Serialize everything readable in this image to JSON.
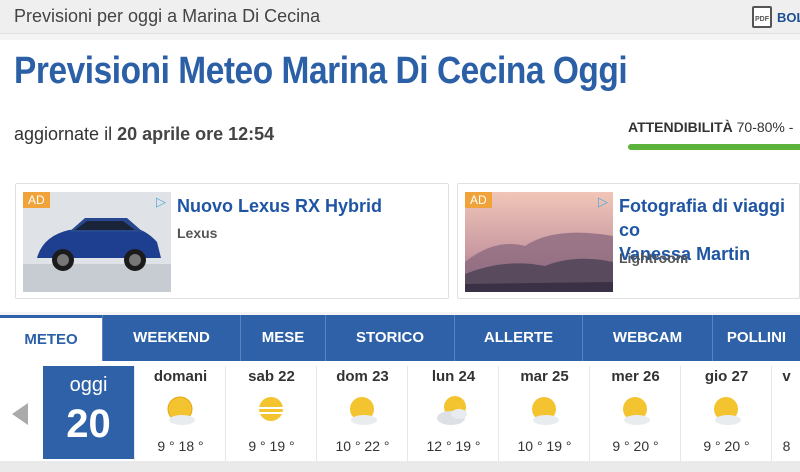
{
  "topbar": {
    "crumb": "Previsioni per oggi a Marina Di Cecina",
    "pdf": "PDF",
    "cutoff": "BOL"
  },
  "header": {
    "title": "Previsioni Meteo Marina Di Cecina Oggi",
    "updated_prefix": "aggiornate il ",
    "updated_date": "20 aprile ore 12:54",
    "reliability_label": "ATTENDIBILITÀ",
    "reliability_value": "70-80% -",
    "reliability_level": 0.75,
    "reliability_color": "#5cb23a"
  },
  "ads": [
    {
      "badge": "AD",
      "headline": "Nuovo Lexus RX Hybrid",
      "brand": "Lexus"
    },
    {
      "badge": "AD",
      "headline_line1": "Fotografia di viaggi co",
      "headline_line2": "Vanessa Martin",
      "brand": "Lightroom"
    }
  ],
  "tabs": [
    {
      "label": "METEO",
      "active": true
    },
    {
      "label": "WEEKEND"
    },
    {
      "label": "MESE"
    },
    {
      "label": "STORICO"
    },
    {
      "label": "ALLERTE"
    },
    {
      "label": "WEBCAM"
    },
    {
      "label": "POLLINI"
    }
  ],
  "today": {
    "label": "oggi",
    "day": "20"
  },
  "days": [
    {
      "name": "domani",
      "temp": "9 ° 18 °",
      "icon": "sun-cloud-icon"
    },
    {
      "name": "sab 22",
      "temp": "9 ° 19 °",
      "icon": "sun-haze-icon"
    },
    {
      "name": "dom 23",
      "temp": "10 ° 22 °",
      "icon": "sun-cloud-icon"
    },
    {
      "name": "lun 24",
      "temp": "12 ° 19 °",
      "icon": "sun-clouds-icon"
    },
    {
      "name": "mar 25",
      "temp": "10 ° 19 °",
      "icon": "sun-cloud-icon"
    },
    {
      "name": "mer 26",
      "temp": "9 ° 20 °",
      "icon": "sun-cloud-icon"
    },
    {
      "name": "gio 27",
      "temp": "9 ° 20 °",
      "icon": "sun-cloud-icon"
    },
    {
      "name": "v",
      "temp": "8",
      "icon": ""
    }
  ],
  "colors": {
    "brand_blue": "#2e61a8",
    "title_blue": "#2b5fa6",
    "ad_badge": "#f0a33a"
  }
}
